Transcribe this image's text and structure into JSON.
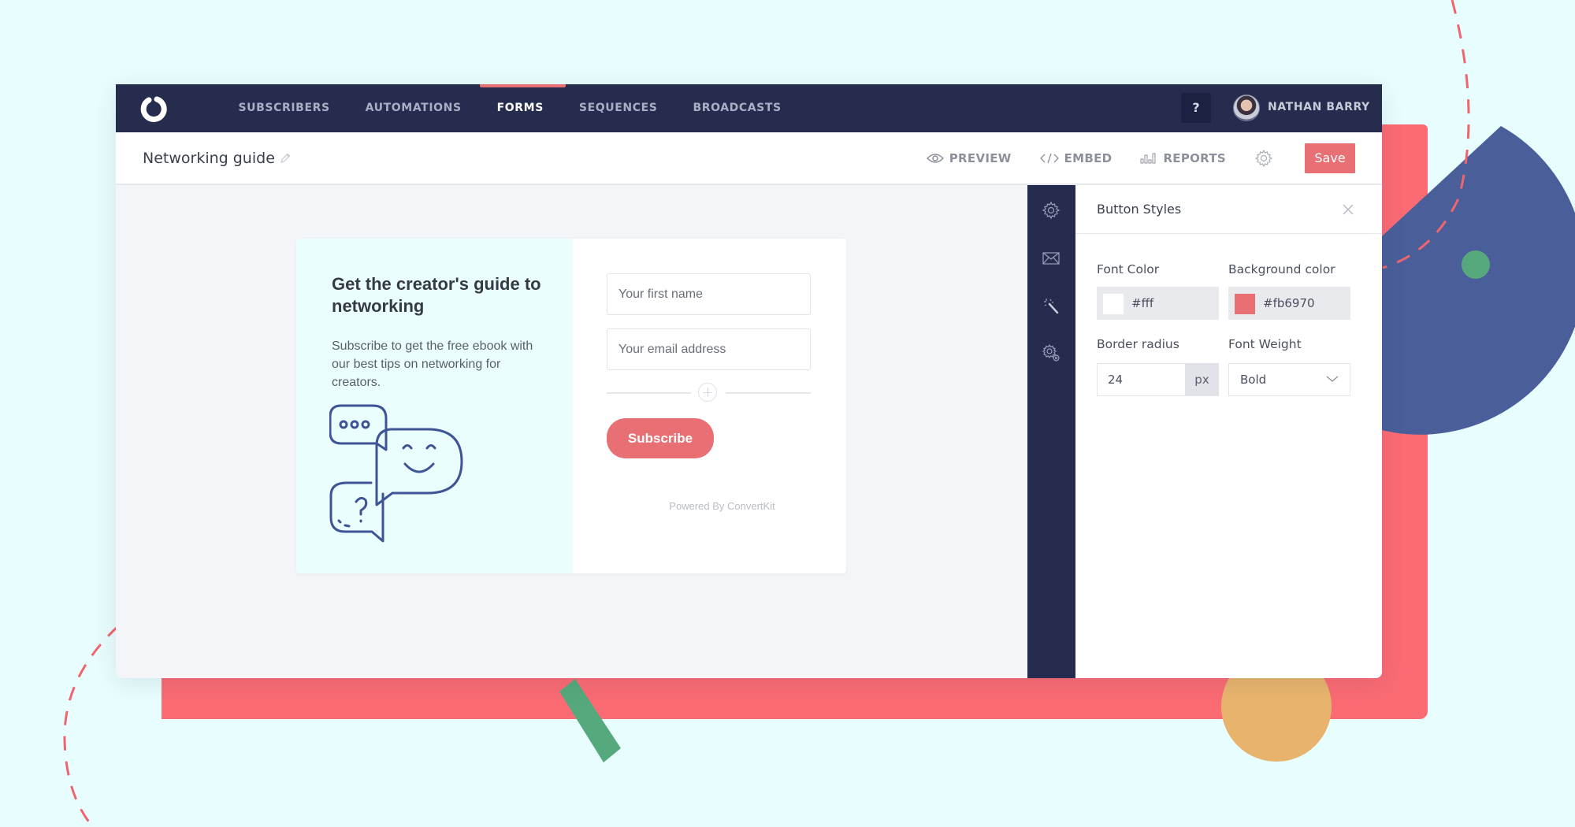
{
  "theme": {
    "nav_bg": "#252c4e",
    "accent": "#e86f74",
    "background": "#e8fdfd",
    "deco_red": "#fa6b74",
    "deco_blue": "#4a5f9a",
    "deco_green": "#56a97c",
    "deco_orange": "#e8b46d"
  },
  "topnav": {
    "logo": "convertkit-logo-icon",
    "items": [
      {
        "label": "SUBSCRIBERS",
        "active": false
      },
      {
        "label": "AUTOMATIONS",
        "active": false
      },
      {
        "label": "FORMS",
        "active": true
      },
      {
        "label": "SEQUENCES",
        "active": false
      },
      {
        "label": "BROADCASTS",
        "active": false
      }
    ],
    "help_label": "?",
    "user_name": "NATHAN BARRY"
  },
  "subbar": {
    "form_title": "Networking guide",
    "actions": [
      {
        "icon": "eye-icon",
        "label": "PREVIEW"
      },
      {
        "icon": "code-icon",
        "label": "EMBED"
      },
      {
        "icon": "bar-chart-icon",
        "label": "REPORTS"
      }
    ],
    "settings_icon": "gear-icon",
    "save_label": "Save"
  },
  "form_preview": {
    "heading": "Get the creator's guide to networking",
    "description": "Subscribe to get the free ebook with our best tips on networking for creators.",
    "illustration": "chat-bubbles-icon",
    "fields": [
      {
        "placeholder": "Your first name",
        "value": ""
      },
      {
        "placeholder": "Your email address",
        "value": ""
      }
    ],
    "subscribe_label": "Subscribe",
    "powered_by": "Powered By ConvertKit"
  },
  "icon_rail": [
    "gear-icon",
    "envelope-icon",
    "magic-wand-icon",
    "advanced-settings-icon"
  ],
  "panel": {
    "title": "Button Styles",
    "font_color_label": "Font Color",
    "font_color_value": "#fff",
    "font_color_swatch": "#ffffff",
    "bg_color_label": "Background color",
    "bg_color_value": "#fb6970",
    "bg_color_swatch": "#e86f74",
    "border_radius_label": "Border radius",
    "border_radius_value": "24",
    "border_radius_unit": "px",
    "font_weight_label": "Font Weight",
    "font_weight_value": "Bold"
  }
}
